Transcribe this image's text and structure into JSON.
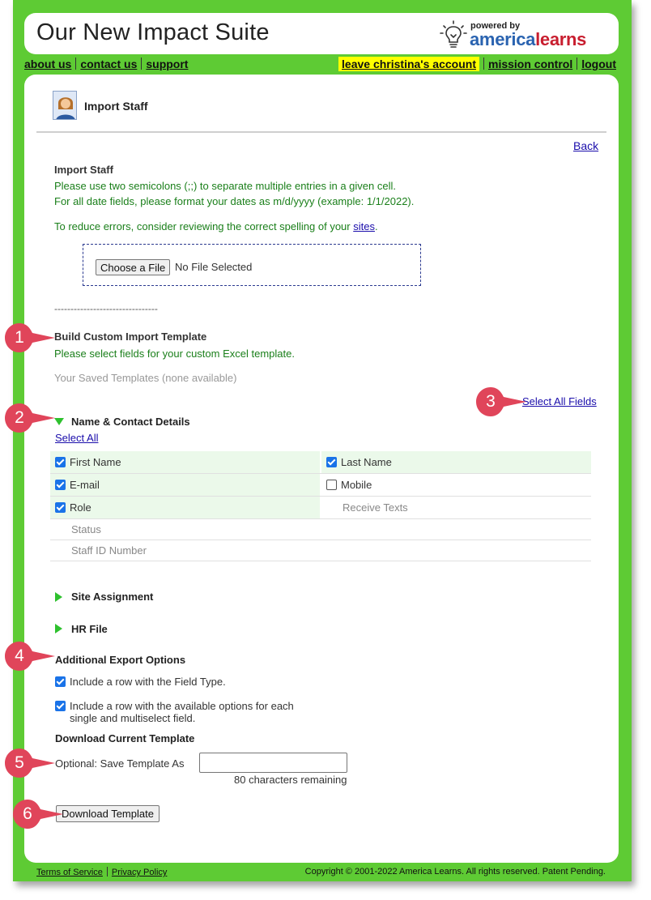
{
  "app": {
    "title": "Our New Impact Suite",
    "logo_powered": "powered by",
    "logo_brand_a": "america",
    "logo_brand_b": "learns"
  },
  "nav": {
    "about": "about us",
    "contact": "contact us",
    "support": "support",
    "leave_account": "leave christina's account",
    "mission_control": "mission control",
    "logout": "logout"
  },
  "page": {
    "heading": "Import Staff",
    "back": "Back"
  },
  "import": {
    "title": "Import Staff",
    "line1": "Please use two semicolons (;;) to separate multiple entries in a given cell.",
    "line2": "For all date fields, please format your dates as m/d/yyyy (example: 1/1/2022).",
    "reduce_prefix": "To reduce errors, consider reviewing the correct spelling of your ",
    "sites_link": "sites",
    "reduce_suffix": ".",
    "choose_file": "Choose a File",
    "no_file": "No File Selected",
    "divider": "--------------------------------"
  },
  "custom_template": {
    "title": "Build Custom Import Template",
    "subtitle": "Please select fields for your custom Excel template.",
    "saved": "Your Saved Templates (none available)",
    "select_all_fields": "Select All Fields"
  },
  "name_contact": {
    "title": "Name & Contact Details",
    "select_all": "Select All",
    "fields": {
      "first_name": "First Name",
      "last_name": "Last Name",
      "email": "E-mail",
      "mobile": "Mobile",
      "role": "Role",
      "receive_texts": "Receive Texts",
      "status": "Status",
      "staff_id": "Staff ID Number"
    }
  },
  "sections": {
    "site_assignment": "Site Assignment",
    "hr_file": "HR File"
  },
  "export_options": {
    "title": "Additional Export Options",
    "opt1": "Include a row with the Field Type.",
    "opt2_line1": "Include a row with the available options for each",
    "opt2_line2": "single and multiselect field."
  },
  "download": {
    "title": "Download Current Template",
    "save_label": "Optional: Save Template As",
    "save_value": "",
    "remaining": "80 characters remaining",
    "button": "Download Template"
  },
  "footer": {
    "terms": "Terms of Service",
    "privacy": "Privacy Policy",
    "copyright": "Copyright © 2001-2022 America Learns. All rights reserved. Patent Pending."
  },
  "markers": [
    "1",
    "2",
    "3",
    "4",
    "5",
    "6"
  ],
  "colors": {
    "frame": "#5ecb34",
    "highlight": "#ffff00",
    "marker": "#e0455a",
    "text_green": "#1a7f1a",
    "row_shade": "#ebf9ea",
    "brand_blue": "#2a63b0",
    "brand_red": "#c81e2f"
  }
}
